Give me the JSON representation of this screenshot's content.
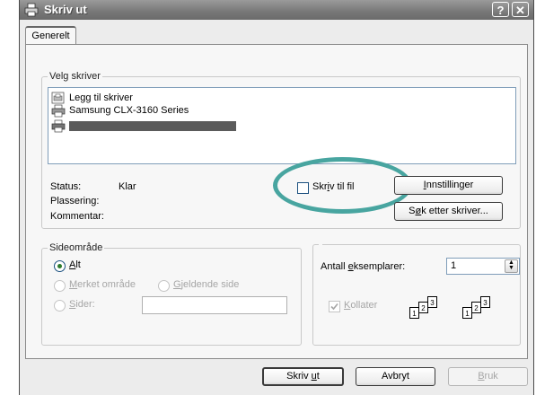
{
  "window": {
    "title": "Skriv ut",
    "help_button": "?",
    "close_button": "✕"
  },
  "tabs": [
    {
      "label": "Generelt"
    }
  ],
  "printer_group": {
    "legend": "Velg skriver",
    "items": [
      {
        "label": "Legg til skriver",
        "icon": "add-printer-icon"
      },
      {
        "label": "Samsung CLX-3160 Series",
        "icon": "printer-icon"
      },
      {
        "label": "",
        "icon": "printer-icon",
        "redacted": true
      }
    ],
    "status_label": "Status:",
    "status_value": "Klar",
    "location_label": "Plassering:",
    "comment_label": "Kommentar:",
    "print_to_file_label": "Skriv til fil",
    "print_to_file_checked": false,
    "preferences_button": "Innstillinger",
    "find_printer_button": "Søk etter skriver..."
  },
  "page_range": {
    "legend": "Sideområde",
    "all_label": "Alt",
    "selection_label": "Merket område",
    "current_page_label": "Gjeldende side",
    "pages_label": "Sider:",
    "pages_value": "",
    "selected": "Alt"
  },
  "copies": {
    "label": "Antall eksemplarer:",
    "value": "1",
    "collate_label": "Kollater",
    "collate_checked": true
  },
  "buttons": {
    "print": "Skriv ut",
    "cancel": "Avbryt",
    "apply": "Bruk"
  },
  "colors": {
    "highlight_ring": "#48a5a0",
    "title_bar": "#777777"
  }
}
